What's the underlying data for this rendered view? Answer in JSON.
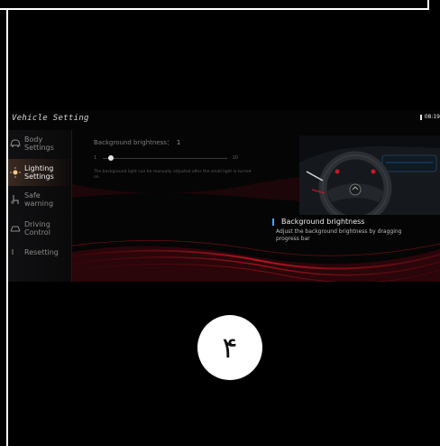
{
  "app": {
    "title": "Vehicle Setting",
    "clock": "08:19"
  },
  "sidebar": {
    "items": [
      {
        "label": "Body\nSettings",
        "icon": "car-body-icon",
        "active": false
      },
      {
        "label": "Lighting\nSettings",
        "icon": "light-icon",
        "active": true
      },
      {
        "label": "Safe\nwarning",
        "icon": "seat-icon",
        "active": false
      },
      {
        "label": "Driving\nControl",
        "icon": "steering-icon",
        "active": false
      },
      {
        "label": "Resetting",
        "icon": "reset-icon",
        "active": false
      }
    ],
    "home_icon": "home-icon"
  },
  "content": {
    "brightness": {
      "label": "Background brightness：",
      "value": "1",
      "min": "1",
      "max": "10",
      "level": 1
    },
    "description": "The background light can be manually adjusted after the small light is turned on.",
    "info": {
      "title": "Background brightness",
      "subtitle": "Adjust the background brightness by dragging progress bar"
    }
  },
  "overlay": {
    "page_number": "۴"
  },
  "colors": {
    "accent_blue": "#3aa7ff",
    "accent_red": "#c4182a",
    "background": "#000000"
  }
}
